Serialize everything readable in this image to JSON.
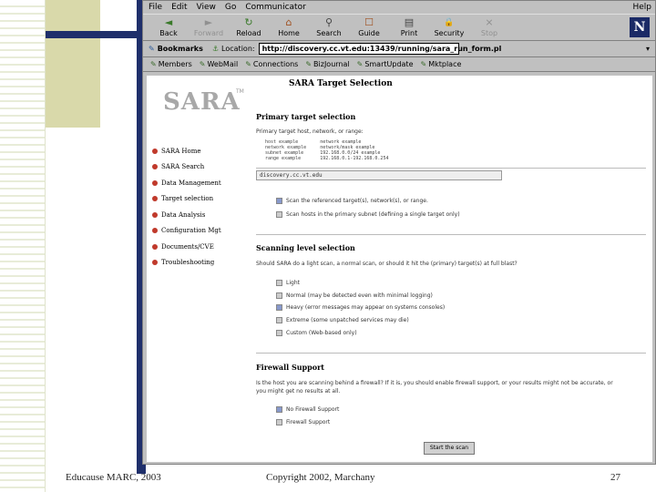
{
  "browser": {
    "menu": [
      "File",
      "Edit",
      "View",
      "Go",
      "Communicator"
    ],
    "help": "Help",
    "toolbar": [
      {
        "label": "Back",
        "icon": "back-arrow-icon",
        "glyph": "◄",
        "disabled": false
      },
      {
        "label": "Forward",
        "icon": "forward-arrow-icon",
        "glyph": "►",
        "disabled": true
      },
      {
        "label": "Reload",
        "icon": "reload-icon",
        "glyph": "↻",
        "disabled": false
      },
      {
        "label": "Home",
        "icon": "home-icon",
        "glyph": "⌂",
        "disabled": false
      },
      {
        "label": "Search",
        "icon": "search-icon",
        "glyph": "⚲",
        "disabled": false
      },
      {
        "label": "Guide",
        "icon": "guide-icon",
        "glyph": "☐",
        "disabled": false
      },
      {
        "label": "Print",
        "icon": "print-icon",
        "glyph": "▤",
        "disabled": false
      },
      {
        "label": "Security",
        "icon": "security-lock-icon",
        "glyph": "🔒",
        "disabled": false
      },
      {
        "label": "Stop",
        "icon": "stop-icon",
        "glyph": "⨯",
        "disabled": true
      }
    ],
    "logo": "N",
    "bookmarks": "Bookmarks",
    "location_label": "Location:",
    "location": "http://discovery.cc.vt.edu:13439/running/sara_run_form.pl",
    "personal": [
      "Members",
      "WebMail",
      "Connections",
      "BizJournal",
      "SmartUpdate",
      "Mktplace"
    ]
  },
  "page": {
    "logo": "SARA",
    "tm": "TM",
    "title": "SARA Target Selection",
    "sidebar": [
      "SARA Home",
      "SARA Search",
      "Data Management",
      "Target selection",
      "Data Analysis",
      "Configuration Mgt",
      "Documents/CVE",
      "Troubleshooting"
    ],
    "primary": {
      "heading": "Primary target selection",
      "hint": "Primary target host, network, or range:",
      "examples": "host example        network example\nnetwork example     network/mask example\nsubnet example      192.168.0.0/24 example\nrange example       192.168.0.1-192.168.0.254",
      "value": "discovery.cc.vt.edu",
      "options": [
        "Scan the referenced target(s), network(s), or range.",
        "Scan hosts in the primary subnet (defining a single target only)"
      ]
    },
    "scanning": {
      "heading": "Scanning level selection",
      "hint": "Should SARA do a light scan, a normal scan, or should it hit the (primary) target(s) at full blast?",
      "options": [
        "Light",
        "Normal (may be detected even with minimal logging)",
        "Heavy (error messages may appear on systems consoles)",
        "Extreme (some unpatched services may die)",
        "Custom (Web-based only)"
      ]
    },
    "firewall": {
      "heading": "Firewall Support",
      "hint1": "Is the host you are scanning behind a firewall? If it is, you should enable firewall support, or your results might not be accurate, or",
      "hint2": "you might get no results at all.",
      "options": [
        "No Firewall Support",
        "Firewall Support"
      ]
    },
    "button": "Start the scan"
  },
  "footer": {
    "left": "Educause MARC, 2003",
    "center": "Copyright 2002, Marchany",
    "page": "27"
  }
}
